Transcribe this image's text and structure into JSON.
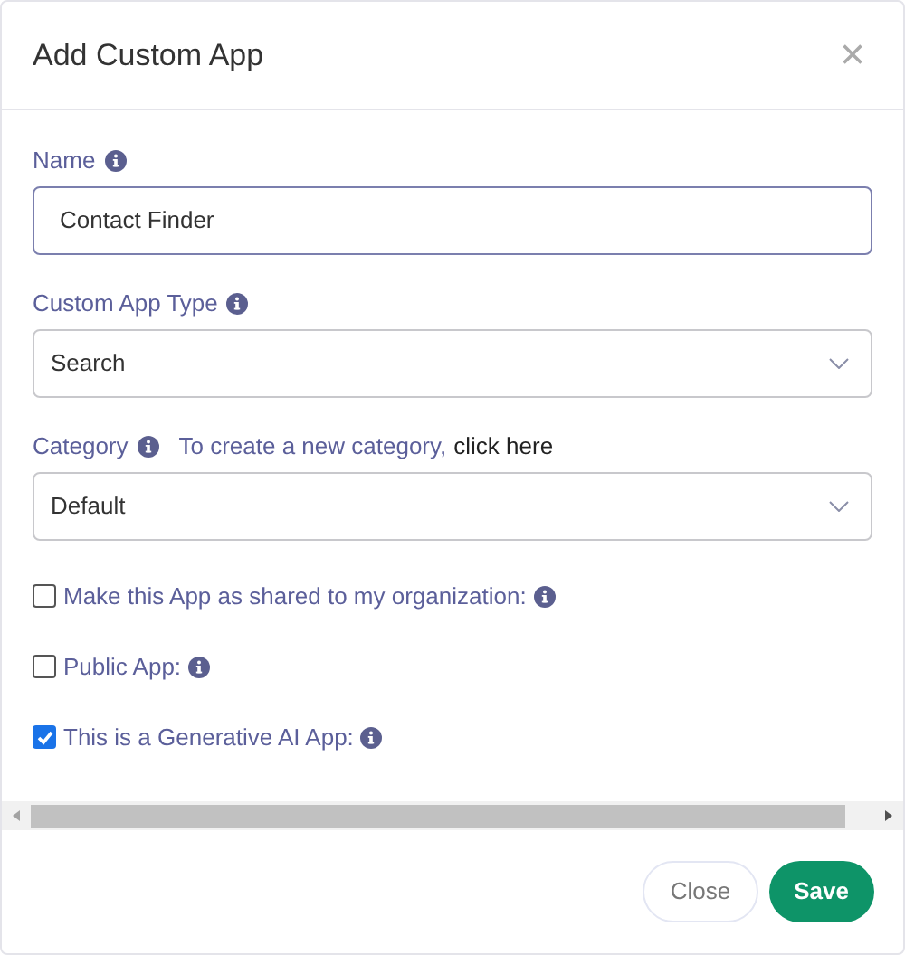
{
  "dialog": {
    "title": "Add Custom App",
    "close_label": "×"
  },
  "fields": [
    {
      "kind": "text",
      "label": "Name",
      "info": true,
      "value": "Contact Finder",
      "focused": true
    },
    {
      "kind": "select",
      "label": "Custom App Type",
      "info": true,
      "value": "Search",
      "focused": false
    },
    {
      "kind": "select",
      "label": "Category",
      "info": true,
      "hint": "To create a new category,",
      "link": "click here",
      "value": "Default",
      "focused": false
    }
  ],
  "checkboxes": [
    {
      "label": "Make this App as shared to my organization:",
      "checked": false
    },
    {
      "label": "Public App:",
      "checked": false
    },
    {
      "label": "This is a Generative AI App:",
      "checked": true
    }
  ],
  "buttons": [
    {
      "label": "Close",
      "kind": "secondary"
    },
    {
      "label": "Save",
      "kind": "primary"
    }
  ]
}
